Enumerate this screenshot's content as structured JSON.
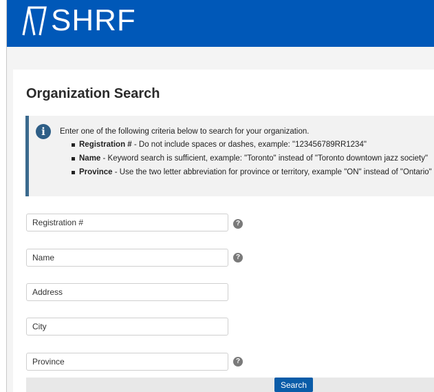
{
  "header": {
    "logo_text": "SHRF",
    "brand_color": "#0058b8"
  },
  "page": {
    "title": "Organization Search"
  },
  "info": {
    "icon": "info-icon",
    "intro": "Enter one of the following criteria below to search for your organization.",
    "items": [
      {
        "label": "Registration #",
        "text": " - Do not include spaces or dashes, example: \"123456789RR1234\""
      },
      {
        "label": "Name",
        "text": " - Keyword search is sufficient, example: \"Toronto\" instead of \"Toronto downtown jazz society\""
      },
      {
        "label": "Province",
        "text": " - Use the two letter abbreviation for province or territory, example \"ON\" instead of \"Ontario\""
      }
    ]
  },
  "form": {
    "registration_placeholder": "Registration #",
    "name_placeholder": "Name",
    "address_placeholder": "Address",
    "city_placeholder": "City",
    "province_placeholder": "Province",
    "help_icon": "question-circle-icon",
    "search_label": "Search"
  }
}
